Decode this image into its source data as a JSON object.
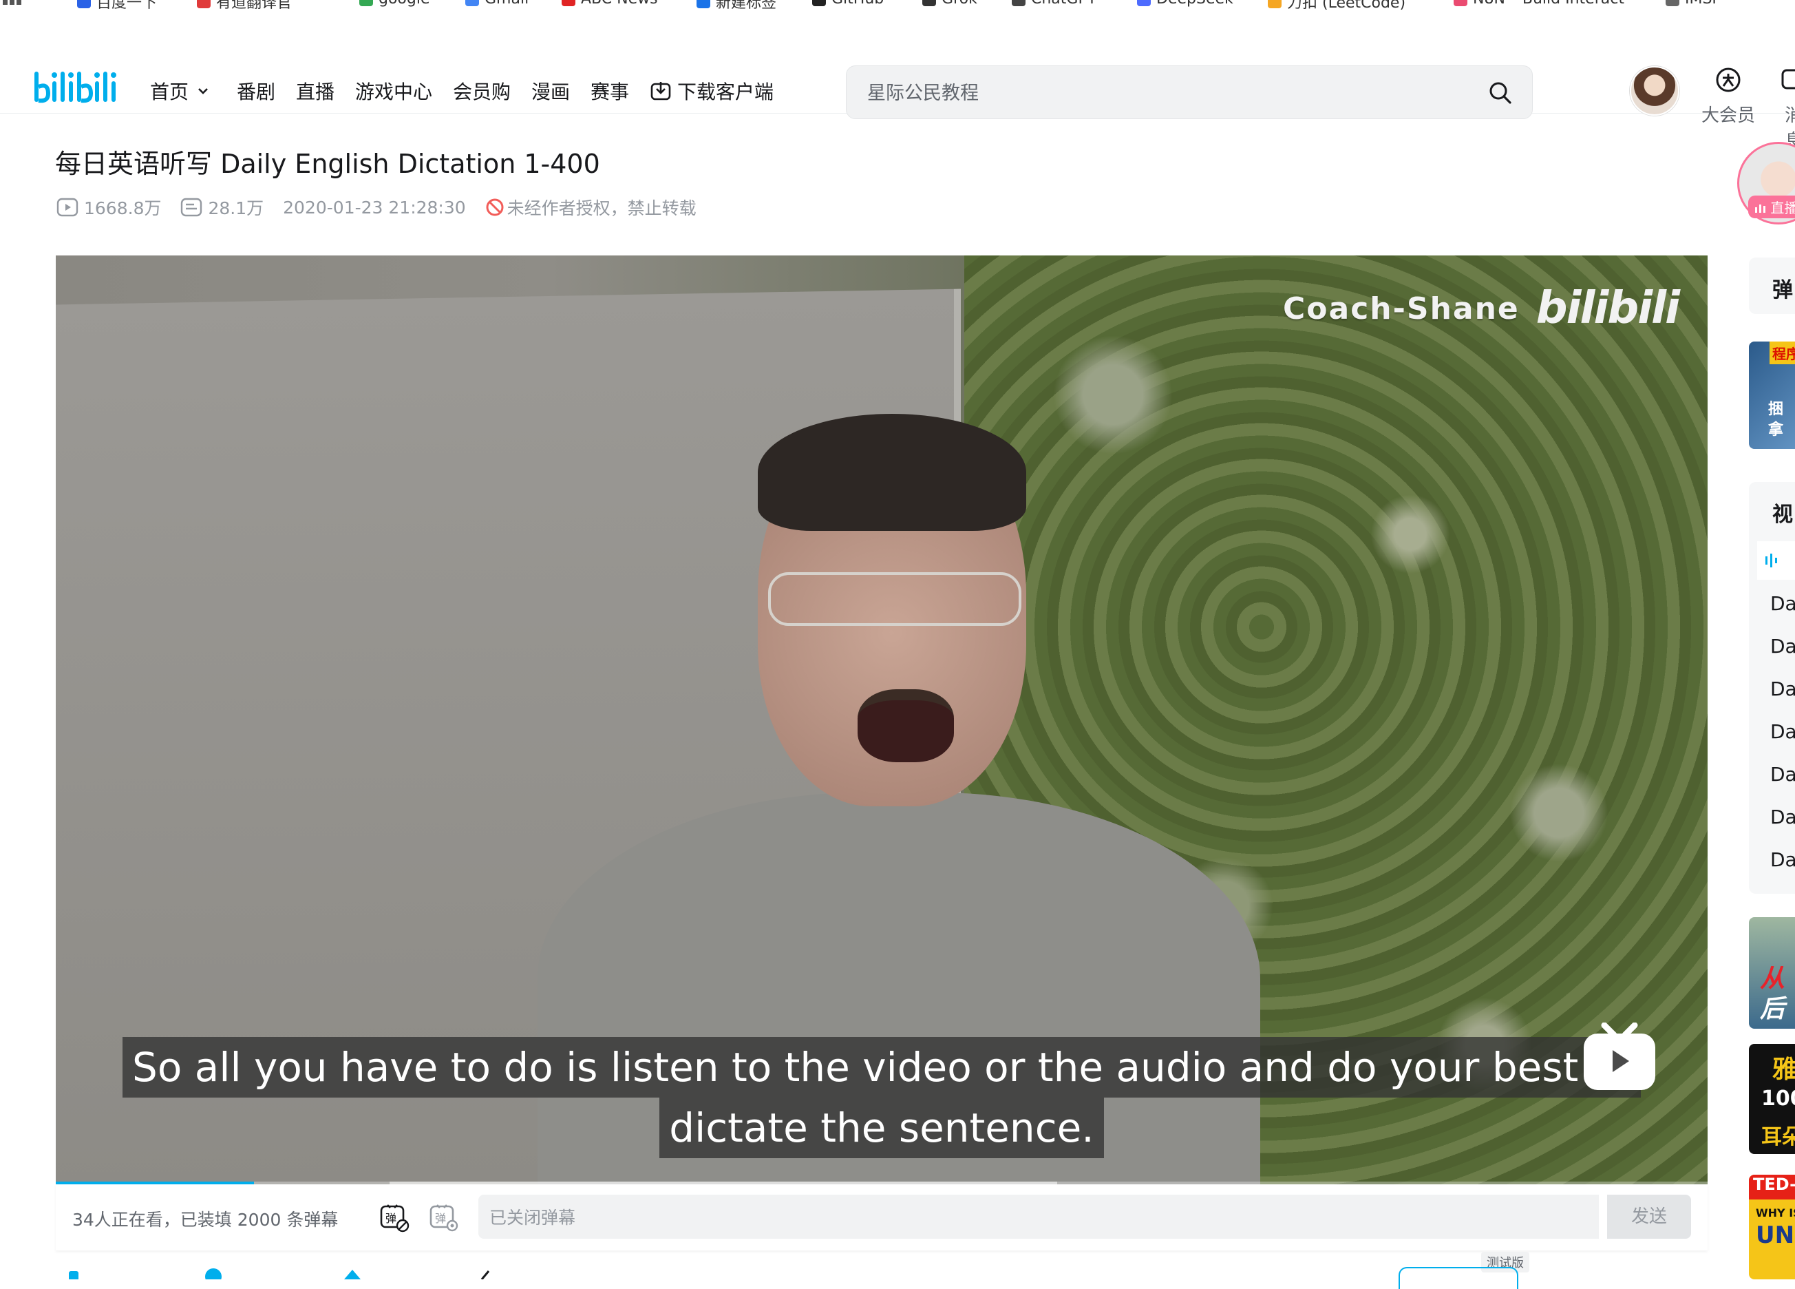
{
  "bookmarks": [
    "百度一下",
    "有道翻译官",
    "google",
    "Gmail",
    "ABC News",
    "新建标签",
    "GitHub",
    "Grok",
    "ChatGPT",
    "DeepSeek",
    "力扣 (LeetCode)",
    "N8N – Build Interact",
    "IMSF"
  ],
  "header": {
    "logo": "bilibili",
    "nav": [
      "首页",
      "番剧",
      "直播",
      "游戏中心",
      "会员购",
      "漫画",
      "赛事",
      "下载客户端"
    ],
    "search_placeholder": "星际公民教程",
    "vip_label": "大会员",
    "msg_label": "消息"
  },
  "video": {
    "title": "每日英语听写 Daily English Dictation 1-400",
    "views": "1668.8万",
    "danmaku_count": "28.1万",
    "date": "2020-01-23 21:28:30",
    "copyright": "未经作者授权，禁止转载",
    "watermark": "Coach-Shane",
    "watermark_logo": "bilibili",
    "subtitle_line1": "So all you have to do is listen to the video or the audio and do your best to",
    "subtitle_line2": "dictate the sentence.",
    "progress_fraction": 0.12
  },
  "danmaku_bar": {
    "status": "34人正在看，已装填 2000 条弹幕",
    "input_placeholder": "已关闭弹幕",
    "send_label": "发送",
    "beta_label": "测试版"
  },
  "sidebar": {
    "live_label": "直播",
    "danmaku_list_label": "弹",
    "playlist_label": "视",
    "playlist_items": [
      "Da",
      "Da",
      "Da",
      "Da",
      "Da",
      "Da",
      "Da"
    ],
    "thumb1_text": [
      "程序",
      "捆",
      "拿"
    ],
    "thumb2_text": [
      "从",
      "后"
    ],
    "thumb3_text": [
      "雅",
      "100",
      "耳朵"
    ],
    "thumb4_text": [
      "TED-",
      "WHY ISN",
      "UND"
    ]
  },
  "colors": {
    "brand_blue": "#00aeec",
    "live_pink": "#fb7299"
  }
}
